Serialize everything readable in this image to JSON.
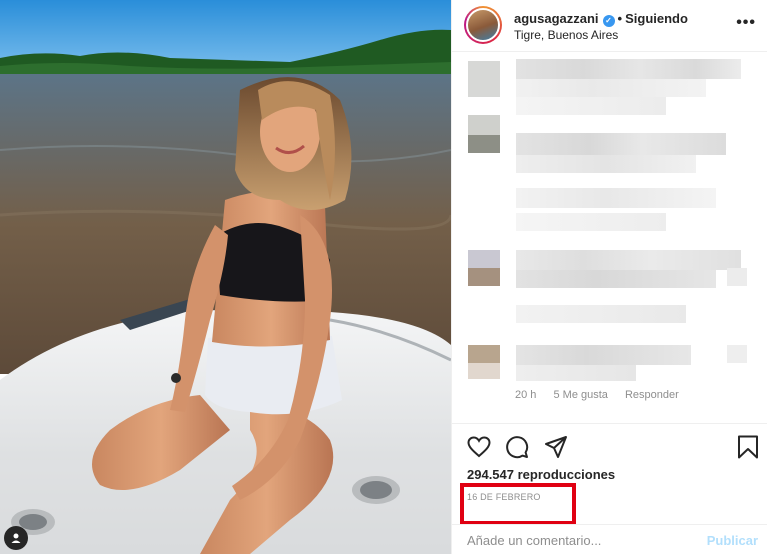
{
  "post": {
    "username": "agusagazzani",
    "separator": "•",
    "follow_status": "Siguiendo",
    "location": "Tigre, Buenos Aires",
    "more_icon": "more-horizontal-icon"
  },
  "comment_meta": {
    "time": "20 h",
    "likes": "5 Me gusta",
    "reply": "Responder"
  },
  "actions": {
    "icons": [
      "heart-icon",
      "comment-icon",
      "share-icon",
      "bookmark-icon"
    ]
  },
  "stats": {
    "views": "294.547 reproducciones",
    "date": "16 DE FEBRERO"
  },
  "comment_box": {
    "placeholder": "Añade un comentario...",
    "publish_label": "Publicar"
  },
  "colors": {
    "highlight": "#e00012",
    "publish_disabled": "#b2dffc",
    "verified": "#3897f0"
  }
}
